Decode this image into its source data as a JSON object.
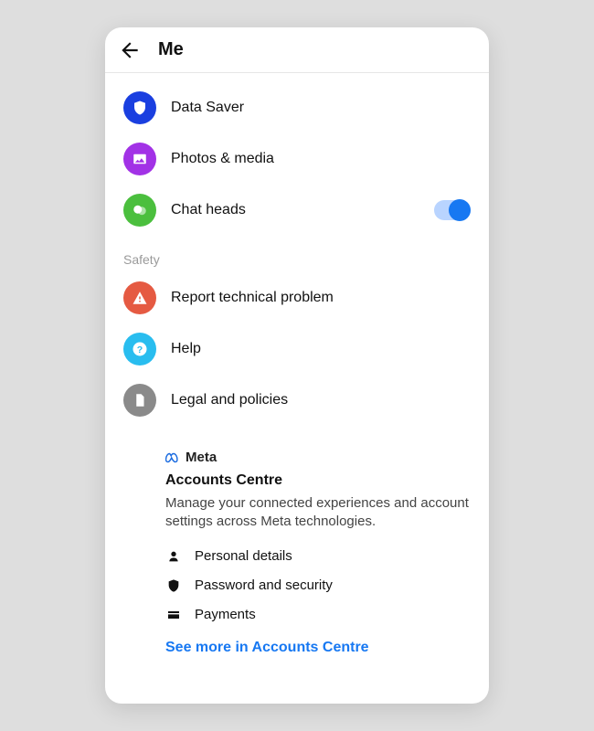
{
  "header": {
    "title": "Me"
  },
  "settings": {
    "items": [
      {
        "label": "Data Saver",
        "color": "#1a3fe0"
      },
      {
        "label": "Photos & media",
        "color": "#a232e6"
      },
      {
        "label": "Chat heads",
        "color": "#4bbf3e",
        "toggle": true
      }
    ]
  },
  "safety": {
    "header": "Safety",
    "items": [
      {
        "label": "Report technical problem",
        "color": "#e55a42"
      },
      {
        "label": "Help",
        "color": "#29bdef"
      },
      {
        "label": "Legal and policies",
        "color": "#8a8a8a"
      }
    ]
  },
  "accounts_centre": {
    "brand": "Meta",
    "title": "Accounts Centre",
    "description": "Manage your connected experiences and account settings across Meta technologies.",
    "items": [
      {
        "label": "Personal details"
      },
      {
        "label": "Password and security"
      },
      {
        "label": "Payments"
      }
    ],
    "link": "See more in Accounts Centre"
  }
}
